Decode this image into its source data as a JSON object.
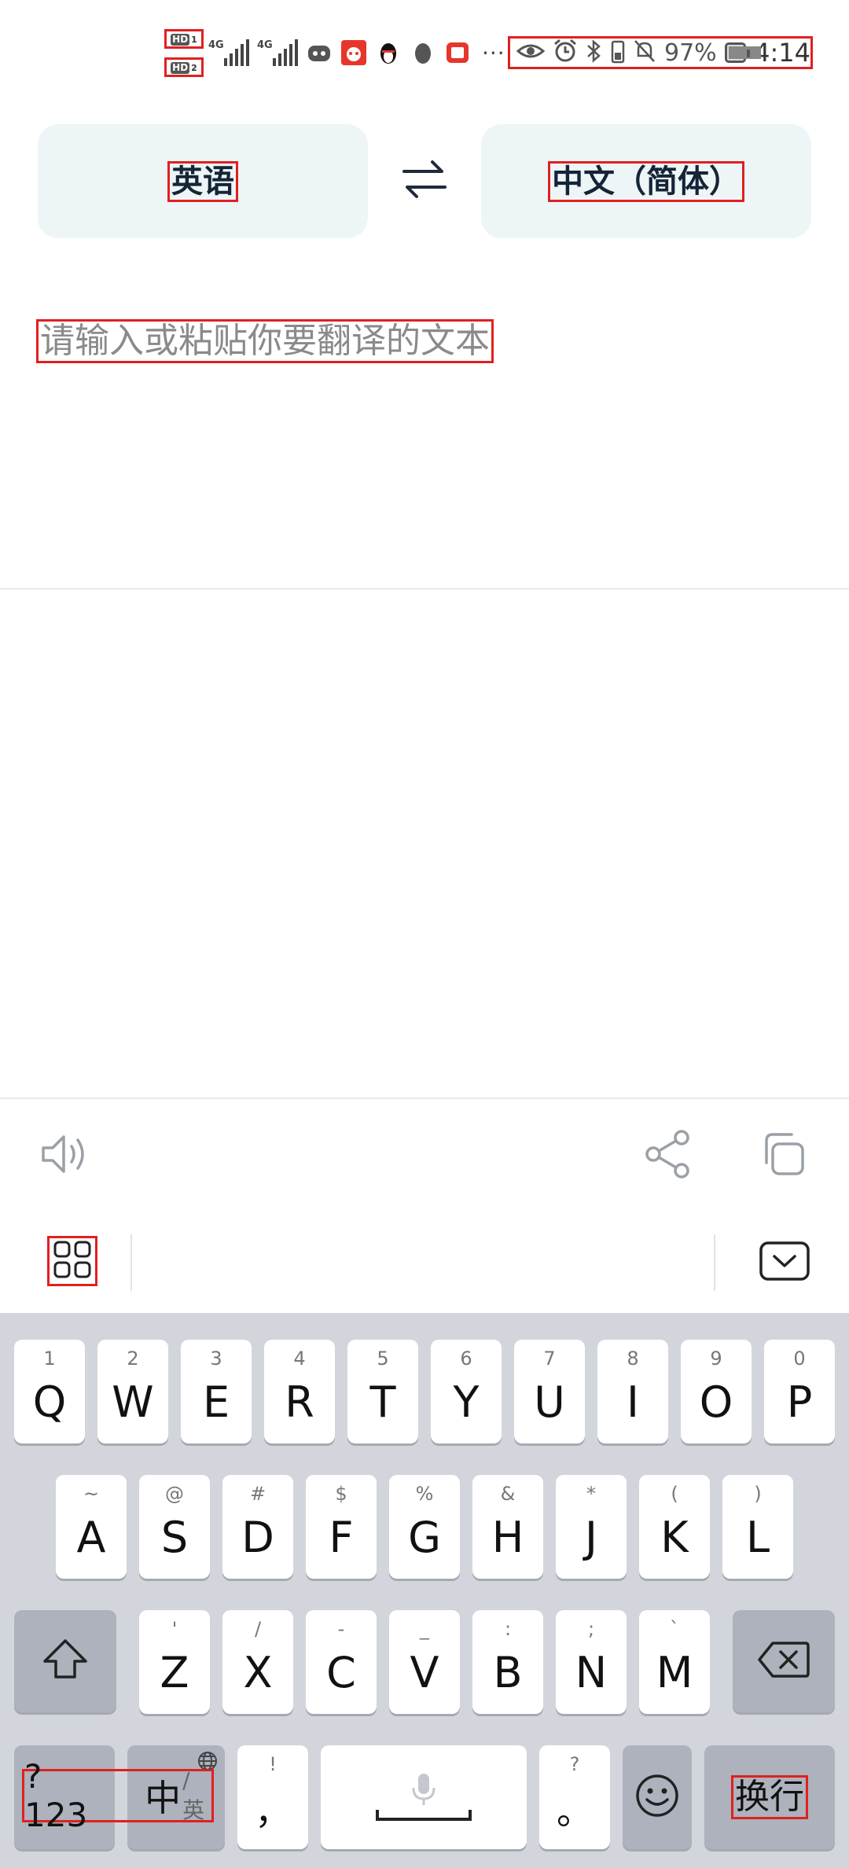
{
  "status_bar": {
    "sim1_badge": "HD",
    "sim1_index": "1",
    "sim2_badge": "HD",
    "sim2_index": "2",
    "network1": "4G",
    "network2": "4G",
    "overflow": "···",
    "battery_percent": "97%",
    "time": "4:14",
    "battery_level": 0.97
  },
  "languages": {
    "source": "英语",
    "target": "中文（简体）"
  },
  "input": {
    "placeholder": "请输入或粘贴你要翻译的文本"
  },
  "keyboard": {
    "row1": [
      {
        "hint": "1",
        "key": "Q"
      },
      {
        "hint": "2",
        "key": "W"
      },
      {
        "hint": "3",
        "key": "E"
      },
      {
        "hint": "4",
        "key": "R"
      },
      {
        "hint": "5",
        "key": "T"
      },
      {
        "hint": "6",
        "key": "Y"
      },
      {
        "hint": "7",
        "key": "U"
      },
      {
        "hint": "8",
        "key": "I"
      },
      {
        "hint": "9",
        "key": "O"
      },
      {
        "hint": "0",
        "key": "P"
      }
    ],
    "row2": [
      {
        "hint": "~",
        "key": "A"
      },
      {
        "hint": "@",
        "key": "S"
      },
      {
        "hint": "#",
        "key": "D"
      },
      {
        "hint": "$",
        "key": "F"
      },
      {
        "hint": "%",
        "key": "G"
      },
      {
        "hint": "&",
        "key": "H"
      },
      {
        "hint": "*",
        "key": "J"
      },
      {
        "hint": "(",
        "key": "K"
      },
      {
        "hint": ")",
        "key": "L"
      }
    ],
    "row3": [
      {
        "hint": "'",
        "key": "Z"
      },
      {
        "hint": "/",
        "key": "X"
      },
      {
        "hint": "-",
        "key": "C"
      },
      {
        "hint": "_",
        "key": "V"
      },
      {
        "hint": ":",
        "key": "B"
      },
      {
        "hint": ";",
        "key": "N"
      },
      {
        "hint": "`",
        "key": "M"
      }
    ],
    "numsym_label": "?123",
    "lang_switch_label": "中",
    "lang_switch_sub": "/英",
    "comma_hint": "!",
    "comma_key": "，",
    "period_hint": "?",
    "period_key": "。",
    "enter_label": "换行"
  }
}
